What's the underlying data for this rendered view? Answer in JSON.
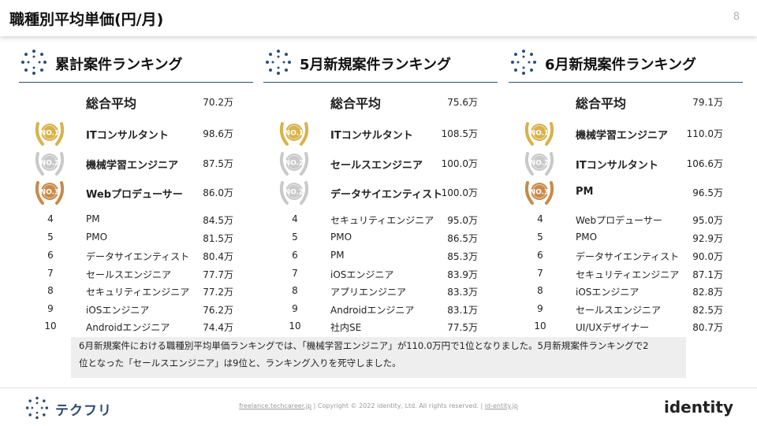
{
  "header": {
    "title": "職種別平均単価(円/月)",
    "page_number": "8"
  },
  "columns": [
    {
      "title": "累計案件ランキング",
      "average": {
        "label": "総合平均",
        "value": "70.2万"
      },
      "rows": [
        {
          "rank": "1",
          "name": "ITコンサルタント",
          "value": "98.6万",
          "medal": "gold"
        },
        {
          "rank": "2",
          "name": "機械学習エンジニア",
          "value": "87.5万",
          "medal": "silver"
        },
        {
          "rank": "3",
          "name": "Webプロデューサー",
          "value": "86.0万",
          "medal": "bronze"
        },
        {
          "rank": "4",
          "name": "PM",
          "value": "84.5万"
        },
        {
          "rank": "5",
          "name": "PMO",
          "value": "81.5万"
        },
        {
          "rank": "6",
          "name": "データサイエンティスト",
          "value": "80.4万"
        },
        {
          "rank": "7",
          "name": "セールスエンジニア",
          "value": "77.7万"
        },
        {
          "rank": "8",
          "name": "セキュリティエンジニア",
          "value": "77.2万"
        },
        {
          "rank": "9",
          "name": "iOSエンジニア",
          "value": "76.2万"
        },
        {
          "rank": "10",
          "name": "Androidエンジニア",
          "value": "74.4万"
        }
      ]
    },
    {
      "title": "5月新規案件ランキング",
      "average": {
        "label": "総合平均",
        "value": "75.6万"
      },
      "rows": [
        {
          "rank": "1",
          "name": "ITコンサルタント",
          "value": "108.5万",
          "medal": "gold"
        },
        {
          "rank": "2",
          "name": "セールスエンジニア",
          "value": "100.0万",
          "medal": "silver"
        },
        {
          "rank": "2",
          "name": "データサイエンティスト",
          "value": "100.0万",
          "medal": "silver"
        },
        {
          "rank": "4",
          "name": "セキュリティエンジニア",
          "value": "95.0万"
        },
        {
          "rank": "5",
          "name": "PMO",
          "value": "86.5万"
        },
        {
          "rank": "6",
          "name": "PM",
          "value": "85.3万"
        },
        {
          "rank": "7",
          "name": "iOSエンジニア",
          "value": "83.9万"
        },
        {
          "rank": "8",
          "name": "アプリエンジニア",
          "value": "83.3万"
        },
        {
          "rank": "9",
          "name": "Androidエンジニア",
          "value": "83.1万"
        },
        {
          "rank": "10",
          "name": "社内SE",
          "value": "77.5万"
        }
      ]
    },
    {
      "title": "6月新規案件ランキング",
      "average": {
        "label": "総合平均",
        "value": "79.1万"
      },
      "rows": [
        {
          "rank": "1",
          "name": "機械学習エンジニア",
          "value": "110.0万",
          "medal": "gold"
        },
        {
          "rank": "2",
          "name": "ITコンサルタント",
          "value": "106.6万",
          "medal": "silver"
        },
        {
          "rank": "3",
          "name": "PM",
          "value": "96.5万",
          "medal": "bronze"
        },
        {
          "rank": "4",
          "name": "Webプロデューサー",
          "value": "95.0万"
        },
        {
          "rank": "5",
          "name": "PMO",
          "value": "92.9万"
        },
        {
          "rank": "6",
          "name": "データサイエンティスト",
          "value": "90.0万"
        },
        {
          "rank": "7",
          "name": "セキュリティエンジニア",
          "value": "87.1万"
        },
        {
          "rank": "8",
          "name": "iOSエンジニア",
          "value": "82.8万"
        },
        {
          "rank": "9",
          "name": "セールスエンジニア",
          "value": "82.5万"
        },
        {
          "rank": "10",
          "name": "UI/UXデザイナー",
          "value": "80.7万"
        }
      ]
    }
  ],
  "note": {
    "line1": "6月新規案件における職種別平均単価ランキングでは、「機械学習エンジニア」が110.0万円で1位となりました。5月新規案件ランキングで2",
    "line2": "位となった「セールスエンジニア」は9位と、ランキング入りを死守しました。"
  },
  "footer": {
    "logo_text": "テクフリ",
    "link1": "freelance.techcareer.jp",
    "copyright": " | Copyright © 2022 identity, Ltd. All rights reserved. | ",
    "link2": "id-entity.jp",
    "brand": "identity"
  },
  "colors": {
    "accent_line": "#2c4f78",
    "logo_blue": "#2b4a6e",
    "brand_dot": "#d62e2e",
    "gold": "#d8b24a",
    "silver": "#c9c9c9",
    "bronze": "#c98a4a"
  },
  "icons": {
    "column_icon": "dotted-circle-icon",
    "medal_icon": "laurel-medal-icon"
  }
}
